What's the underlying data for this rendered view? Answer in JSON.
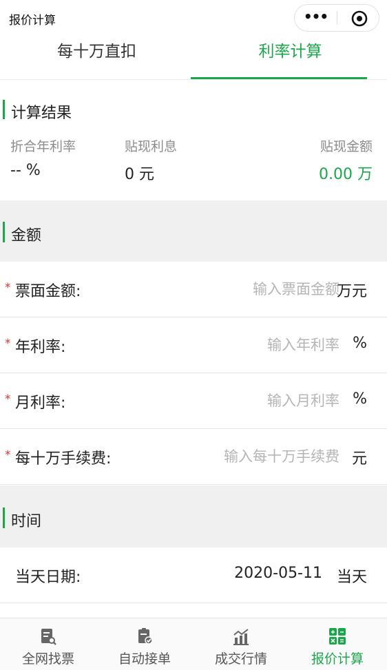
{
  "nav": {
    "title": "报价计算",
    "more_icon": "more-dots-icon",
    "close_icon": "target-close-icon"
  },
  "tabs": [
    {
      "label": "每十万直扣",
      "active": false
    },
    {
      "label": "利率计算",
      "active": true
    }
  ],
  "result": {
    "title": "计算结果",
    "annual_rate_label": "折合年利率",
    "annual_rate_value": "-- %",
    "interest_label": "贴现利息",
    "interest_value": "0 元",
    "amount_label": "贴现金额",
    "amount_value": "0.00 万"
  },
  "amount_section": {
    "title": "金额",
    "fields": [
      {
        "required_mark": "*",
        "label": "票面金额:",
        "placeholder": "输入票面金额",
        "value": "",
        "unit": "万元"
      },
      {
        "required_mark": "*",
        "label": "年利率:",
        "placeholder": "输入年利率",
        "value": "",
        "unit": "%"
      },
      {
        "required_mark": "*",
        "label": "月利率:",
        "placeholder": "输入月利率",
        "value": "",
        "unit": "%"
      },
      {
        "required_mark": "*",
        "label": "每十万手续费:",
        "placeholder": "输入每十万手续费",
        "value": "",
        "unit": "元"
      }
    ]
  },
  "time_section": {
    "title": "时间",
    "date_label": "当天日期:",
    "date_value": "2020-05-11",
    "today_label": "当天"
  },
  "tabbar": [
    {
      "label": "全网找票",
      "icon": "ticket-search-icon",
      "active": false
    },
    {
      "label": "自动接单",
      "icon": "document-check-icon",
      "active": false
    },
    {
      "label": "成交行情",
      "icon": "market-chart-icon",
      "active": false
    },
    {
      "label": "报价计算",
      "icon": "calculator-grid-icon",
      "active": true
    }
  ],
  "colors": {
    "accent": "#18a84a",
    "required": "#e0322d",
    "section_bg": "#f0f0f0"
  }
}
